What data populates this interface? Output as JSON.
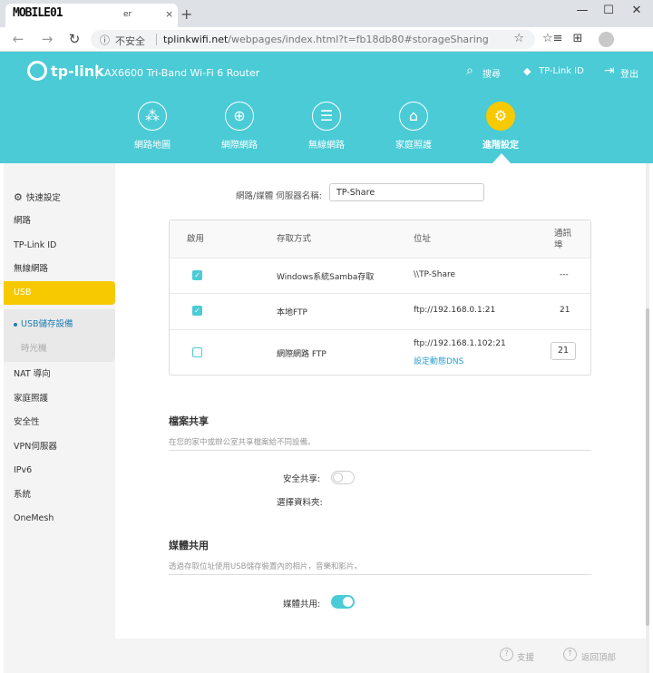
{
  "browser": {
    "tab_logo": "MOBILE01",
    "tab_title": "er",
    "tab_close": "×",
    "new_tab": "+",
    "window": {
      "minimize": "—",
      "maximize": "☐",
      "close": "✕"
    },
    "nav": {
      "back": "←",
      "forward": "→",
      "reload": "↻"
    },
    "info": "ⓘ",
    "security": "不安全",
    "url_host": "tplinkwifi.net",
    "url_path": "/webpages/index.html?t=fb18db80#storageSharing",
    "star": "☆",
    "favorites": "☆≡",
    "collections": "⊞"
  },
  "header": {
    "logo": "tp-link",
    "model": "AX6600 Tri-Band Wi-Fi 6 Router",
    "search_icon": "⌕",
    "search": "搜尋",
    "id_icon": "◆",
    "tplink_id": "TP-Link ID",
    "logout_icon": "⇥",
    "logout": "登出",
    "nav": [
      {
        "label": "網路地圖",
        "icon": "network-map-icon",
        "glyph": "⁂"
      },
      {
        "label": "網際網路",
        "icon": "globe-icon",
        "glyph": "⊕"
      },
      {
        "label": "無線網路",
        "icon": "wifi-icon",
        "glyph": "☰"
      },
      {
        "label": "家庭照護",
        "icon": "home-care-icon",
        "glyph": "⌂"
      },
      {
        "label": "進階設定",
        "icon": "gear-icon",
        "glyph": "⚙"
      }
    ]
  },
  "sidebar": {
    "quick_icon": "⚙",
    "items": [
      "快速設定",
      "網路",
      "TP-Link ID",
      "無線網路",
      "USB",
      "NAT 導向",
      "家庭照護",
      "安全性",
      "VPN伺服器",
      "IPv6",
      "系統",
      "OneMesh"
    ],
    "sub_items": [
      "USB儲存設備",
      "時光機"
    ]
  },
  "content": {
    "server_label": "網路/媒體 伺服器名稱:",
    "server_name": "TP-Share",
    "table": {
      "headers": [
        "啟用",
        "存取方式",
        "位址",
        "通訊埠"
      ],
      "rows": [
        {
          "enabled": true,
          "method": "Windows系統Samba存取",
          "address": "\\\\TP-Share",
          "port": "---"
        },
        {
          "enabled": true,
          "method": "本地FTP",
          "address": "ftp://192.168.0.1:21",
          "port": "21"
        },
        {
          "enabled": false,
          "method": "網際網路 FTP",
          "address": "ftp://192.168.1.102:21",
          "link": "設定動態DNS",
          "port": "21"
        }
      ]
    },
    "file_share": {
      "title": "檔案共享",
      "desc": "在您的家中或辦公室共享檔案給不同設備。",
      "secure_label": "安全共享:",
      "secure_on": false,
      "folder_label": "選擇資料夾:"
    },
    "media_share": {
      "title": "媒體共用",
      "desc": "透過存取位址使用USB儲存裝置內的相片，音樂和影片。",
      "label": "媒體共用:",
      "on": true
    }
  },
  "footer": {
    "support_icon": "?",
    "support": "支援",
    "top_icon": "↑",
    "back_to_top": "返回頂部"
  },
  "colors": {
    "accent": "#4acbd6",
    "active": "#f7c900",
    "link": "#2aa0d0"
  }
}
